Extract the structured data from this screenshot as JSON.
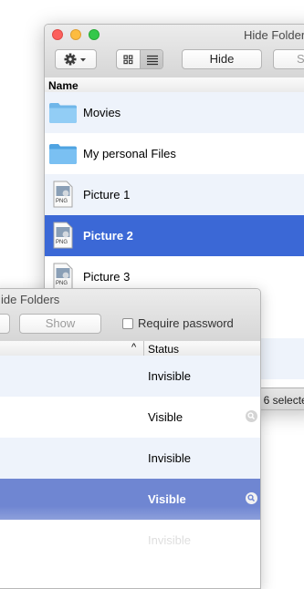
{
  "back_window": {
    "title": "Hide Folders",
    "toolbar": {
      "hide_label": "Hide",
      "partial_button_label": "S"
    },
    "column_header": "Name",
    "rows": [
      {
        "name": "Movies",
        "icon": "folder-icon"
      },
      {
        "name": "My personal Files",
        "icon": "folder-icon"
      },
      {
        "name": "Picture 1",
        "icon": "png-file-icon"
      },
      {
        "name": "Picture 2",
        "icon": "png-file-icon",
        "selected": true
      },
      {
        "name": "Picture 3",
        "icon": "png-file-icon"
      }
    ],
    "file_type_label": "PNG",
    "footer_fragment": "f 6 selecte"
  },
  "front_window": {
    "title_fragment": "ide Folders",
    "toolbar": {
      "show_label": "Show",
      "require_password_label": "Require password",
      "require_password_checked": false
    },
    "status_header": "Status",
    "sort_indicator": "^",
    "rows": [
      {
        "status": "Invisible",
        "magnifier": false
      },
      {
        "status": "Visible",
        "magnifier": true
      },
      {
        "status": "Invisible",
        "magnifier": false
      },
      {
        "status": "Visible",
        "magnifier": true,
        "selected": true
      },
      {
        "status": "Invisible",
        "magnifier": false
      }
    ]
  },
  "colors": {
    "selection": "#3b68d6",
    "alt_row": "#eef3fb",
    "close": "#fc605c",
    "minimize": "#fdbc40",
    "zoom": "#34c84a"
  }
}
